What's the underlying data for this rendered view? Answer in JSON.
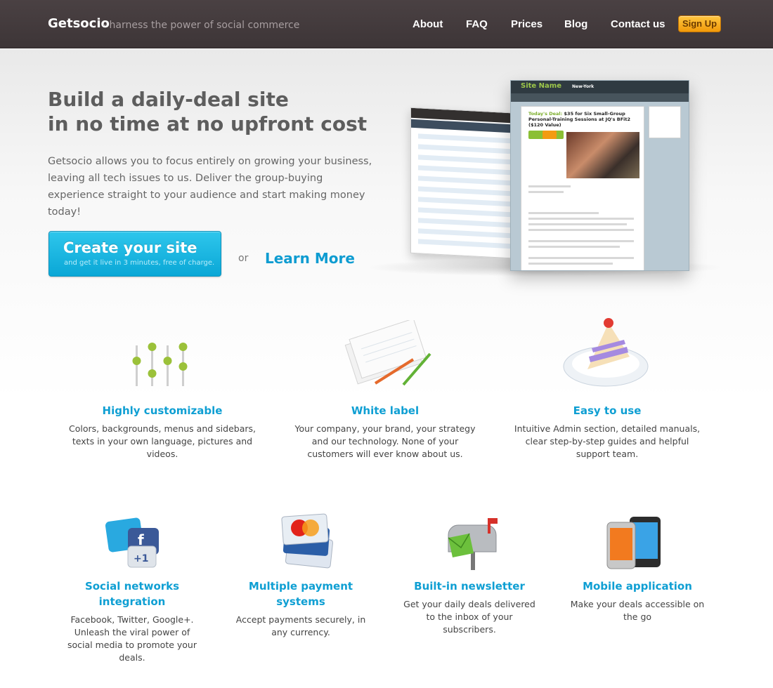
{
  "header": {
    "brand": "Getsocio",
    "tagline": "- harness the power of social commerce",
    "nav": [
      "About",
      "FAQ",
      "Prices",
      "Blog",
      "Contact us"
    ],
    "signup_label": "Sign Up"
  },
  "hero": {
    "title_line1": "Build a daily-deal site",
    "title_line2": "in no time at no upfront cost",
    "description": "Getsocio allows you to focus entirely on growing your business, leaving all tech issues to us. Deliver the group-buying experience straight to your audience and start making money today!",
    "cta_label": "Create your site",
    "cta_sublabel": "and get it live in 3 minutes, free of charge.",
    "or_text": "or",
    "learn_more": "Learn More"
  },
  "mockup": {
    "site_name": "Site Name",
    "city": "New-York",
    "deal_prefix": "Today's Deal:",
    "deal_text": "$35 for Six Small-Group Personal-Training Sessions at JQ's BFit2 ($120 Value)"
  },
  "features_row1": [
    {
      "icon": "sliders-icon",
      "title": "Highly customizable",
      "desc": "Colors, backgrounds, menus and sidebars, texts in your own language, pictures and videos."
    },
    {
      "icon": "notecards-pencils-icon",
      "title": "White label",
      "desc": "Your company, your brand, your strategy and our technology. None of your customers will ever know about us."
    },
    {
      "icon": "cake-slice-icon",
      "title": "Easy to use",
      "desc": "Intuitive Admin section, detailed manuals, clear step-by-step guides and helpful support team."
    }
  ],
  "features_row2": [
    {
      "icon": "social-networks-icon",
      "title": "Social networks integration",
      "desc": "Facebook, Twitter, Google+. Unleash the viral power of social media to promote your deals."
    },
    {
      "icon": "credit-cards-icon",
      "title": "Multiple payment systems",
      "desc": "Accept payments securely, in any currency."
    },
    {
      "icon": "mailbox-icon",
      "title": "Built-in newsletter",
      "desc": "Get your daily deals delivered to the inbox of your subscribers."
    },
    {
      "icon": "mobile-phones-icon",
      "title": "Mobile application",
      "desc": "Make your deals accessible on the go"
    }
  ]
}
